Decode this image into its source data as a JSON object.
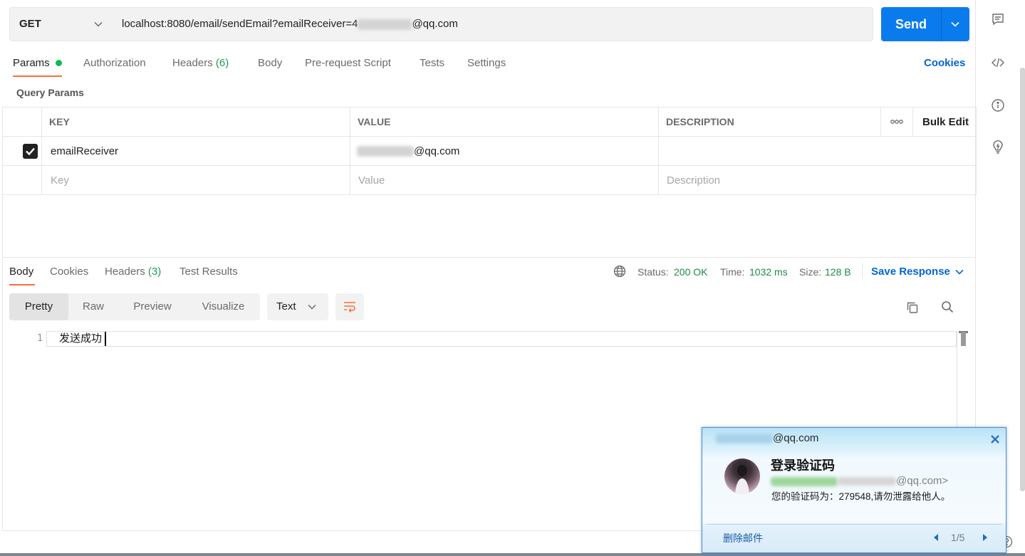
{
  "request": {
    "method": "GET",
    "url_prefix": "localhost:8080/email/sendEmail?emailReceiver=4",
    "url_suffix": "@qq.com",
    "send_label": "Send"
  },
  "request_tabs": [
    {
      "label": "Params",
      "active": true,
      "has_indicator_dot": true
    },
    {
      "label": "Authorization"
    },
    {
      "label": "Headers",
      "count": "(6)"
    },
    {
      "label": "Body"
    },
    {
      "label": "Pre-request Script"
    },
    {
      "label": "Tests"
    },
    {
      "label": "Settings"
    }
  ],
  "cookies_link": "Cookies",
  "query_params": {
    "title": "Query Params",
    "columns": {
      "key": "KEY",
      "value": "VALUE",
      "description": "DESCRIPTION",
      "bulk_edit": "Bulk Edit"
    },
    "rows": [
      {
        "checked": true,
        "key": "emailReceiver",
        "value_visible": "@qq.com",
        "description": ""
      }
    ],
    "new_row_placeholders": {
      "key": "Key",
      "value": "Value",
      "description": "Description"
    }
  },
  "response": {
    "tabs": [
      {
        "label": "Body",
        "active": true
      },
      {
        "label": "Cookies"
      },
      {
        "label": "Headers",
        "count": "(3)"
      },
      {
        "label": "Test Results"
      }
    ],
    "status": {
      "label": "Status:",
      "value": "200 OK"
    },
    "time": {
      "label": "Time:",
      "value": "1032 ms"
    },
    "size": {
      "label": "Size:",
      "value": "128 B"
    },
    "save_response": "Save Response",
    "view_modes": [
      "Pretty",
      "Raw",
      "Preview",
      "Visualize"
    ],
    "active_view_mode": "Pretty",
    "content_type": "Text",
    "body_lines": [
      {
        "number": "1",
        "text": "发送成功"
      }
    ]
  },
  "notification": {
    "account_visible": "@qq.com",
    "subject": "登录验证码",
    "sender_visible": "@qq.com>",
    "preview": "您的验证码为：279548,请勿泄露给他人。",
    "delete_label": "删除邮件",
    "pager": "1/5"
  },
  "icons": {
    "sidebar": [
      "comment-icon",
      "code-icon",
      "info-icon",
      "lightbulb-icon"
    ],
    "response_toolbar": [
      "globe-icon",
      "wrap-lines-icon",
      "copy-icon",
      "search-icon"
    ],
    "notification": [
      "close-icon",
      "avatar",
      "prev-arrow-icon",
      "next-arrow-icon"
    ]
  },
  "colors": {
    "accent_orange": "#FF6C37",
    "send_blue": "#097BED",
    "link_blue": "#0265D2",
    "indicator_green": "#0CBB52",
    "status_green": "#1E8A44",
    "notification_border": "#4A8FD3"
  }
}
